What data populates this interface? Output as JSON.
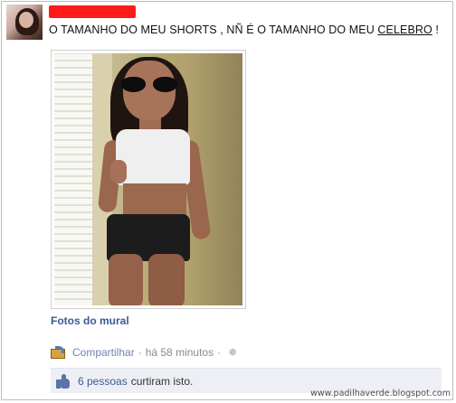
{
  "post": {
    "text_before": "O TAMANHO DO MEU SHORTS , NÑ É O TAMANHO DO MEU ",
    "text_underlined": "CELEBRO",
    "text_after": " !"
  },
  "album": {
    "label": "Fotos do mural"
  },
  "meta": {
    "share_label": "Compartilhar",
    "separator": "·",
    "timestamp": "há 58 minutos",
    "icon": "gear-icon"
  },
  "likes": {
    "count_text": "6 pessoas",
    "suffix": " curtiram isto.",
    "icon": "like-thumb-icon"
  },
  "watermark": "www.padilhaverde.blogspot.com",
  "colors": {
    "link": "#3b5998",
    "meta_link": "#6d84b4",
    "likes_bg": "#edeff4",
    "redaction": "#ff1a1a"
  }
}
